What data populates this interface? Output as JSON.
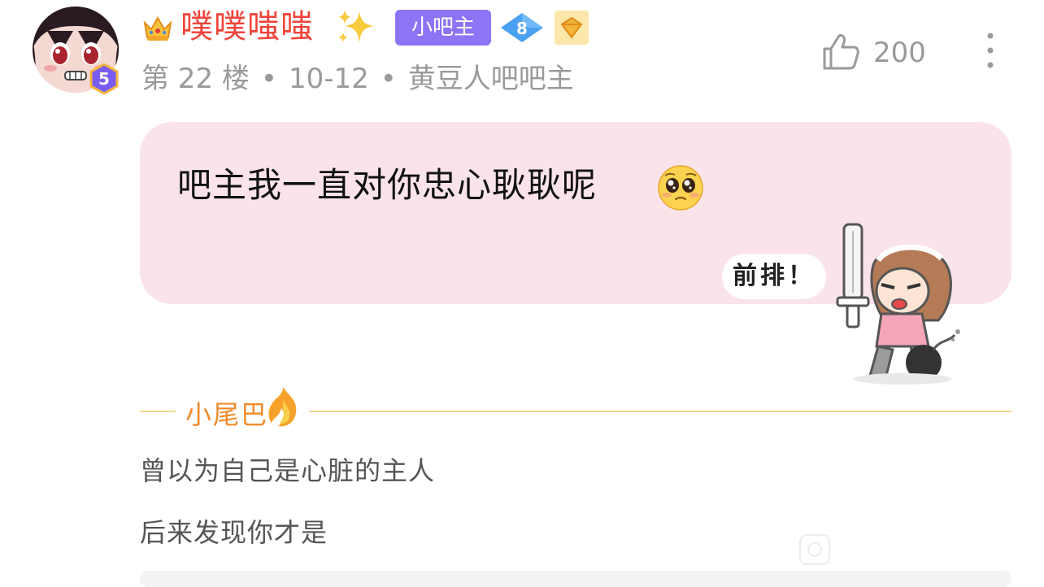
{
  "user": {
    "name": "噗噗嗤嗤",
    "level": "5",
    "role_badge": "小吧主",
    "diamond_level": "8",
    "icons": [
      "crown-icon",
      "sparkle-icon",
      "diamond-icon",
      "vip-icon"
    ]
  },
  "meta": {
    "floor": "第 22 楼",
    "date": "10-12",
    "title": "黄豆人吧吧主"
  },
  "actions": {
    "like_count": "200",
    "like_icon": "thumbs-up-icon",
    "more_icon": "more-vertical-icon"
  },
  "post": {
    "text": "吧主我一直对你忠心耿耿呢",
    "emoji": "pleading-face-icon",
    "sticker_text": "前排！"
  },
  "tail": {
    "label": "小尾巴",
    "lines": [
      "曾以为自己是心脏的主人",
      "后来发现你才是"
    ]
  },
  "colors": {
    "username": "#f0443a",
    "role_badge": "#8c74f4",
    "bubble": "#fae3e9",
    "tail_label": "#f08a2a",
    "divider": "#efd98f",
    "meta": "#9a9a9a"
  }
}
